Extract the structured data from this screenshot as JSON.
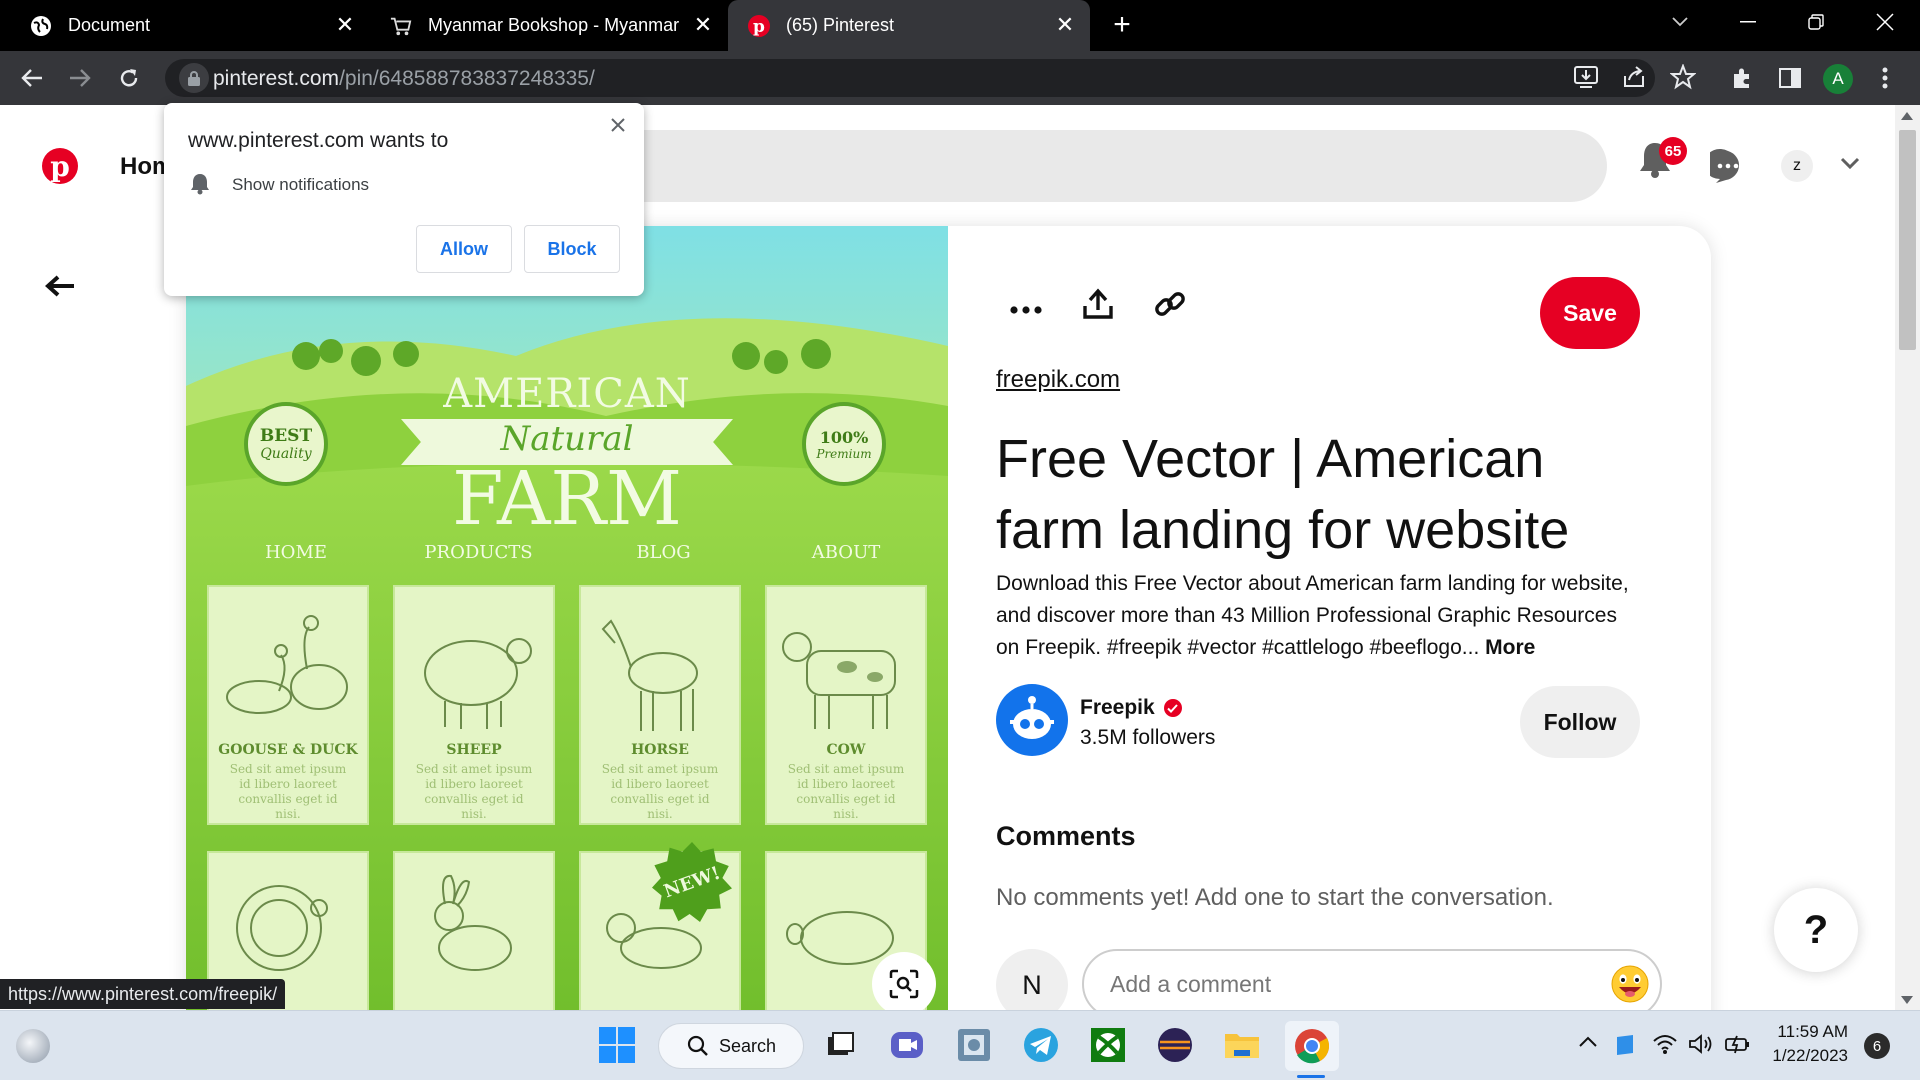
{
  "browser": {
    "tabs": [
      {
        "title": "Document",
        "active": false
      },
      {
        "title": "Myanmar Bookshop - Myanmar B",
        "active": false
      },
      {
        "title": "(65) Pinterest",
        "active": true
      }
    ],
    "new_tab_symbol": "+",
    "url_host": "pinterest.com",
    "url_path": "/pin/648588783837248335/",
    "profile_initial": "A",
    "status_link": "https://www.pinterest.com/freepik/"
  },
  "notification_popup": {
    "title": "www.pinterest.com wants to",
    "permission": "Show notifications",
    "allow_label": "Allow",
    "block_label": "Block"
  },
  "pinterest": {
    "home_label": "Home",
    "notification_count": "65",
    "user_initial": "z",
    "pin": {
      "source": "freepik.com",
      "title": "Free Vector | American farm landing for website",
      "description": "Download this Free Vector about American farm landing for website, and discover more than 43 Million Professional Graphic Resources on Freepik. #freepik #vector #cattlelogo #beeflogo...",
      "more_label": "More",
      "save_label": "Save",
      "creator": {
        "name": "Freepik",
        "followers": "3.5M followers",
        "follow_label": "Follow"
      },
      "comments_heading": "Comments",
      "no_comments_text": "No comments yet! Add one to start the conversation.",
      "commenter_initial": "N",
      "comment_placeholder": "Add a comment"
    },
    "help_label": "?",
    "image": {
      "banner_line1": "AMERICAN",
      "banner_line2": "Natural",
      "banner_line3": "FARM",
      "badge_left_1": "BEST",
      "badge_left_2": "Quality",
      "badge_right_1": "100%",
      "badge_right_2": "Premium",
      "nav": [
        "HOME",
        "PRODUCTS",
        "BLOG",
        "ABOUT"
      ],
      "animals": [
        {
          "name": "GOOUSE & DUCK",
          "desc": "Sed sit amet ipsum id libero laoreet convallis eget id nisi."
        },
        {
          "name": "SHEEP",
          "desc": "Sed sit amet ipsum id libero laoreet convallis eget id nisi."
        },
        {
          "name": "HORSE",
          "desc": "Sed sit amet ipsum id libero laoreet convallis eget id nisi."
        },
        {
          "name": "COW",
          "desc": "Sed sit amet ipsum id libero laoreet convallis eget id nisi."
        }
      ],
      "new_badge": "NEW!"
    }
  },
  "taskbar": {
    "search_label": "Search",
    "time": "11:59 AM",
    "date": "1/22/2023",
    "notif_count": "6"
  }
}
